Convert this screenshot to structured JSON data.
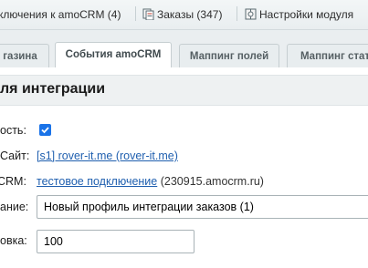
{
  "top_panel": {
    "item1": "ключения к amoCRM (4)",
    "item2": "Заказы (347)",
    "item3": "Настройки модуля"
  },
  "tabs": [
    {
      "label": "газина"
    },
    {
      "label": "События amoCRM"
    },
    {
      "label": "Маппинг полей"
    },
    {
      "label": "Маппинг стат"
    }
  ],
  "section": {
    "title": "ля интеграции"
  },
  "form": {
    "active_label": "ость:",
    "active_checked": true,
    "site_label": "Сайт:",
    "site_link": "[s1] rover-it.me (rover-it.me)",
    "crm_label": "CRM:",
    "crm_link": "тестовое подключение",
    "crm_domain": "(230915.amocrm.ru)",
    "name_label": "ание:",
    "name_value": "Новый профиль интеграции заказов (1)",
    "sort_label": "овка:",
    "sort_value": "100"
  }
}
